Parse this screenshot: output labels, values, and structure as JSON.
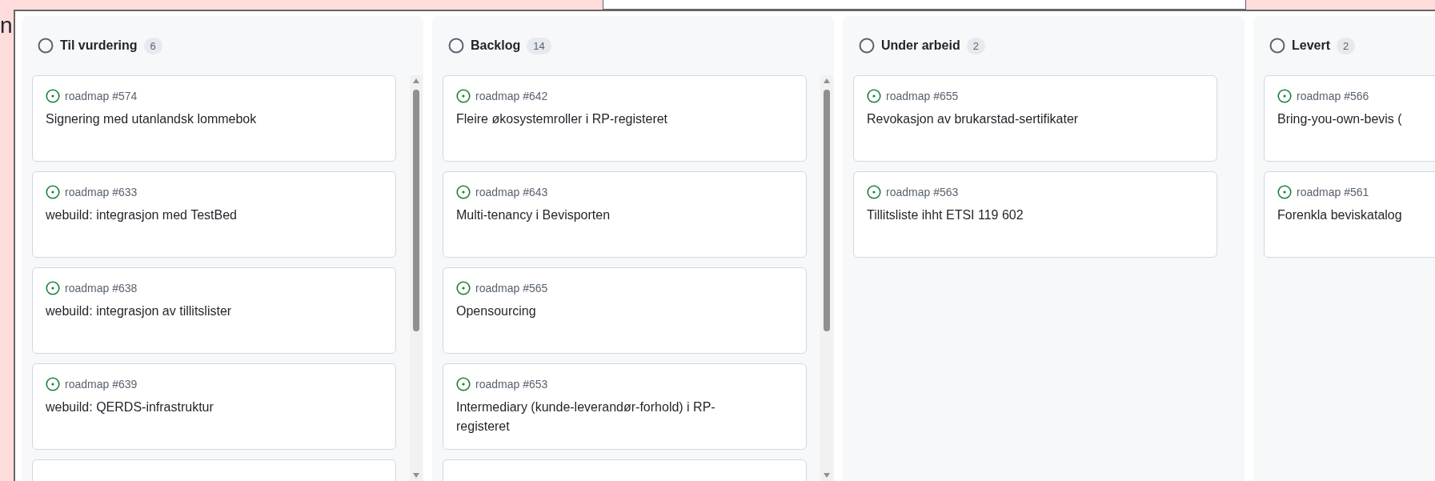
{
  "page_heading_fragment": "n",
  "columns": [
    {
      "title": "Til vurdering",
      "count": "6",
      "scrollable": true,
      "has_more": true,
      "cards": [
        {
          "ref": "roadmap #574",
          "title": "Signering med utanlandsk lommebok"
        },
        {
          "ref": "roadmap #633",
          "title": "webuild: integrasjon med TestBed"
        },
        {
          "ref": "roadmap #638",
          "title": "webuild: integrasjon av tillitslister"
        },
        {
          "ref": "roadmap #639",
          "title": "webuild: QERDS-infrastruktur"
        }
      ]
    },
    {
      "title": "Backlog",
      "count": "14",
      "scrollable": true,
      "has_more": true,
      "cards": [
        {
          "ref": "roadmap #642",
          "title": "Fleire økosystemroller i RP-registeret"
        },
        {
          "ref": "roadmap #643",
          "title": "Multi-tenancy i Bevisporten"
        },
        {
          "ref": "roadmap #565",
          "title": "Opensourcing"
        },
        {
          "ref": "roadmap #653",
          "title": "Intermediary (kunde-leverandør-forhold) i RP-registeret"
        }
      ]
    },
    {
      "title": "Under arbeid",
      "count": "2",
      "scrollable": false,
      "has_more": false,
      "cards": [
        {
          "ref": "roadmap #655",
          "title": "Revokasjon av brukarstad-sertifikater"
        },
        {
          "ref": "roadmap #563",
          "title": "Tillitsliste ihht ETSI 119 602"
        }
      ]
    },
    {
      "title": "Levert",
      "count": "2",
      "scrollable": false,
      "has_more": false,
      "cards": [
        {
          "ref": "roadmap #566",
          "title": "Bring-you-own-bevis ("
        },
        {
          "ref": "roadmap #561",
          "title": "Forenkla beviskatalog"
        }
      ]
    }
  ]
}
